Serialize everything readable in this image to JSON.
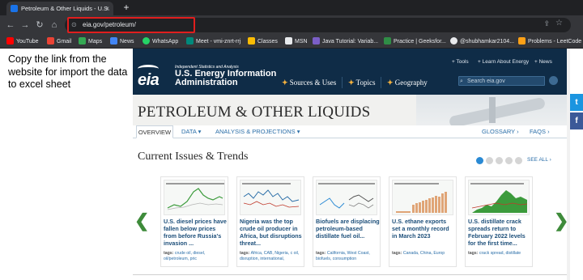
{
  "browser": {
    "tab_title": "Petroleum & Other Liquids - U.S.",
    "tab_close": "×",
    "new_tab": "+",
    "url": "eia.gov/petroleum/",
    "nav": {
      "back": "←",
      "forward": "→",
      "reload": "↻",
      "home": "⌂",
      "lock": "⊙",
      "share": "⇪",
      "star": "☆"
    },
    "bookmarks": [
      {
        "label": "YouTube",
        "color": "#ff0000"
      },
      {
        "label": "Gmail",
        "color": "#ea4335"
      },
      {
        "label": "Maps",
        "color": "#34a853"
      },
      {
        "label": "News",
        "color": "#4285f4"
      },
      {
        "label": "WhatsApp",
        "color": "#25d366"
      },
      {
        "label": "Meet - vmi-znrt-rrj",
        "color": "#00897b"
      },
      {
        "label": "Classes",
        "color": "#fbbc04"
      },
      {
        "label": "MSN",
        "color": "#ffffff"
      },
      {
        "label": "Java Tutorial: Variab...",
        "color": "#7b5fc7"
      },
      {
        "label": "Practice | Geeksfor...",
        "color": "#2f8d46"
      },
      {
        "label": "@shubhamkar2104...",
        "color": "#ffffff"
      },
      {
        "label": "Problems - LeetCode",
        "color": "#ffa116"
      }
    ]
  },
  "note": "Copy the link from the website for import the data to excel sheet",
  "eia": {
    "logo": "eia",
    "tagline": "Independent Statistics and Analysis",
    "name": "U.S. Energy Information Administration",
    "main_nav": [
      "Sources & Uses",
      "Topics",
      "Geography"
    ],
    "util_nav": [
      "Tools",
      "Learn About Energy",
      "News"
    ],
    "search_placeholder": "Search eia.gov",
    "page_title": "PETROLEUM & OTHER LIQUIDS",
    "sub_nav": [
      "OVERVIEW",
      "DATA",
      "ANALYSIS & PROJECTIONS",
      "GLOSSARY ›",
      "FAQS ›"
    ],
    "section_title": "Current Issues & Trends",
    "see_all": "SEE ALL ›",
    "cards": [
      {
        "title": "U.S. diesel prices have fallen below prices from before Russia's invasion ...",
        "tags_label": "tags:",
        "tags": "crude oil, diesel, oil/petroleum, pric"
      },
      {
        "title": "Nigeria was the top crude oil producer in Africa, but disruptions threat...",
        "tags_label": "tags:",
        "tags": "Africa, CAB, Nigeria, c oil, disruption, international,"
      },
      {
        "title": "Biofuels are displacing petroleum-based distillate fuel oil...",
        "tags_label": "tags:",
        "tags": "California, West Coast, biofuels, consumption"
      },
      {
        "title": "U.S. ethane exports set a monthly record in March 2023",
        "tags_label": "tags:",
        "tags": "Canada, China, Europ"
      },
      {
        "title": "U.S. distillate crack spreads return to February 2022 levels for the first time...",
        "tags_label": "tags:",
        "tags": "crack spread, distillate"
      }
    ],
    "arrows": {
      "left": "❮",
      "right": "❯"
    },
    "share": {
      "twitter": "t",
      "facebook": "f"
    }
  }
}
